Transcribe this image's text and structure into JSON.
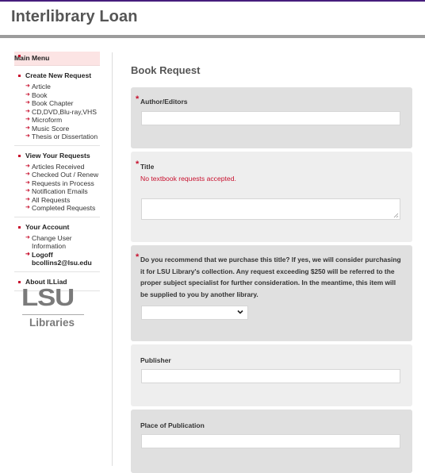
{
  "header": {
    "title": "Interlibrary Loan"
  },
  "colors": {
    "brand_purple": "#461d7c",
    "accent_red": "#c8102e",
    "section_dark": "#e0e0e0",
    "section_light": "#eeeeee"
  },
  "sidebar": {
    "main_menu": "Main Menu",
    "create_new_request": {
      "label": "Create New Request",
      "items": [
        "Article",
        "Book",
        "Book Chapter",
        "CD,DVD,Blu-ray,VHS",
        "Microform",
        "Music Score",
        "Thesis or Dissertation"
      ]
    },
    "view_your_requests": {
      "label": "View Your Requests",
      "items": [
        "Articles Received",
        "Checked Out / Renew",
        "Requests in Process",
        "Notification Emails",
        "All Requests",
        "Completed Requests"
      ]
    },
    "your_account": {
      "label": "Your Account",
      "change_user_line1": "Change User",
      "change_user_line2": "Information",
      "logoff": "Logoff",
      "username": "bcollins2@lsu.edu"
    },
    "about": "About ILLiad",
    "logo": {
      "wordmark": "LSU",
      "subtitle": "Libraries"
    }
  },
  "main": {
    "page_title": "Book Request",
    "fields": {
      "author": {
        "label": "Author/Editors",
        "required": true,
        "value": ""
      },
      "title": {
        "label": "Title",
        "required": true,
        "note": "No textbook requests accepted.",
        "value": ""
      },
      "purchase": {
        "label": "Do you recommend that we purchase this title? If yes, we will consider purchasing it for LSU Library's collection. Any request exceeding $250 will be referred to the proper subject specialist for further consideration. In the meantime, this item will be supplied to you by another library.",
        "required": true,
        "selected": ""
      },
      "publisher": {
        "label": "Publisher",
        "required": false,
        "value": ""
      },
      "place": {
        "label": "Place of Publication",
        "required": false,
        "value": ""
      }
    }
  }
}
